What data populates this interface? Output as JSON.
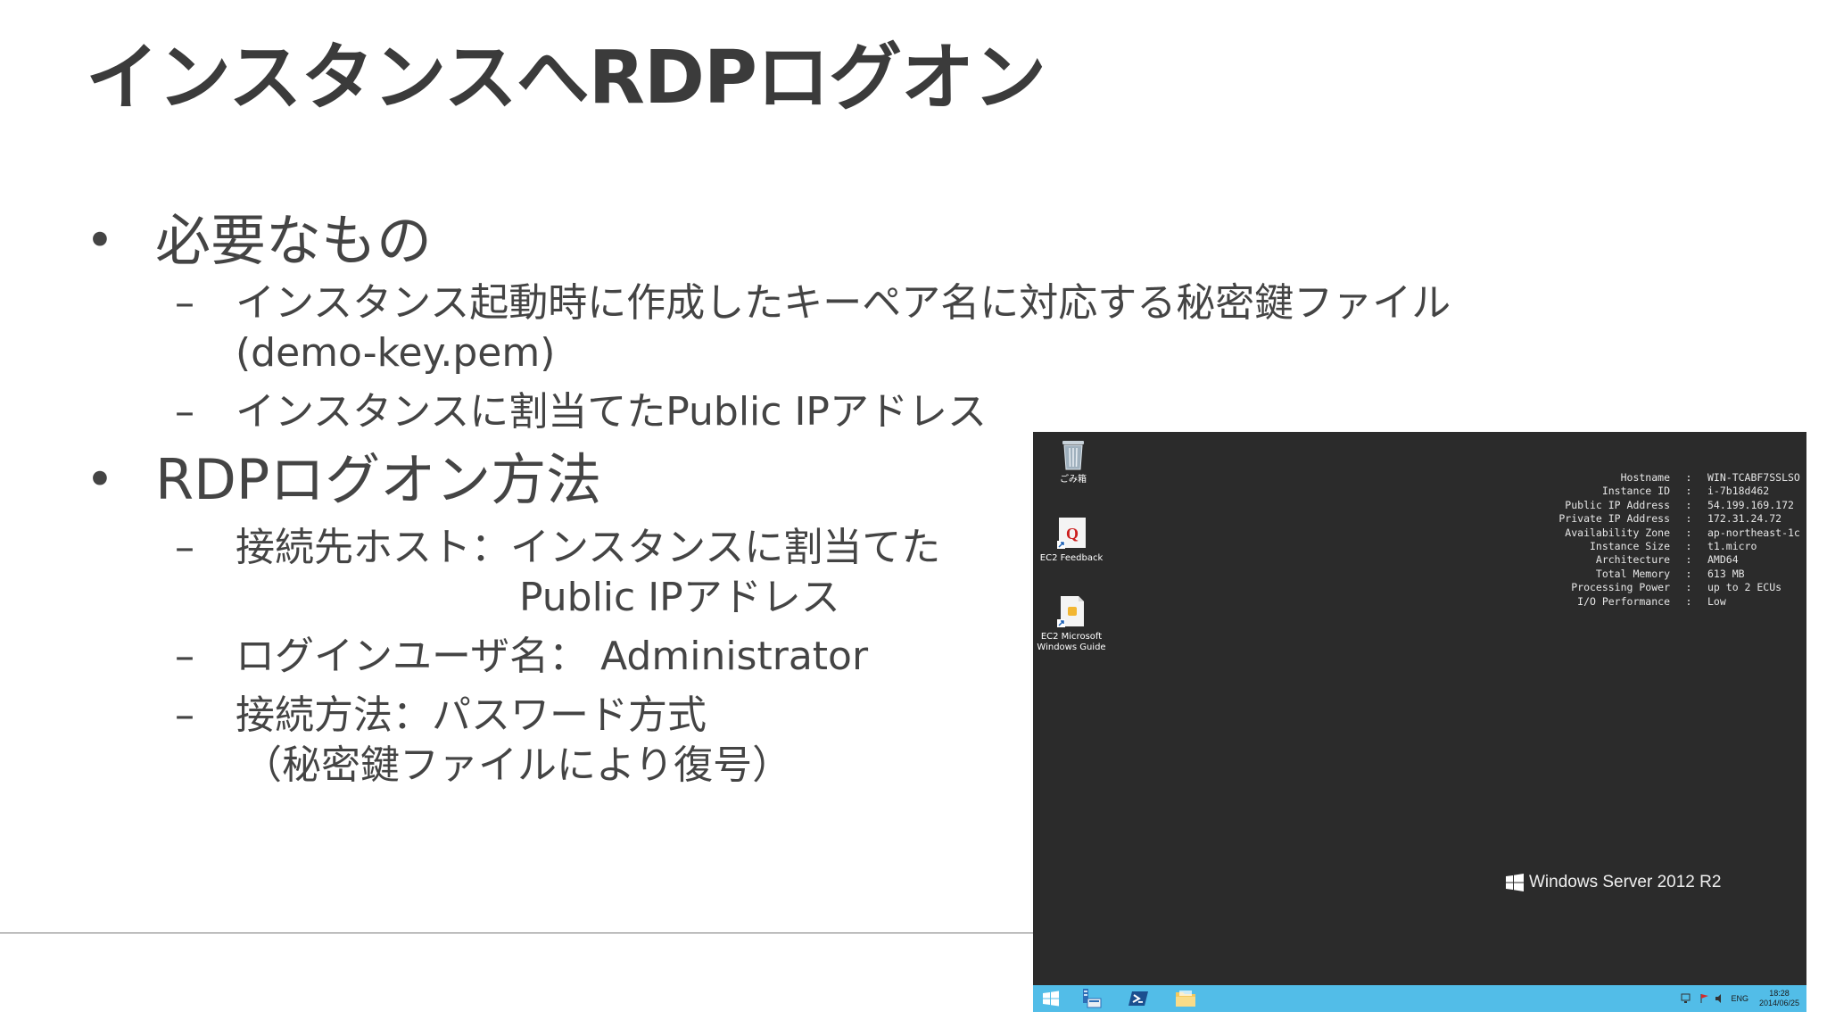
{
  "slide": {
    "title": "インスタンスへRDPログオン",
    "bullets": [
      {
        "label": "必要なもの",
        "items": [
          {
            "lines": [
              "インスタンス起動時に作成したキーペア名に対応する秘密鍵ファイル",
              "(demo-key.pem)"
            ]
          },
          {
            "lines": [
              "インスタンスに割当てたPublic IPアドレス"
            ]
          }
        ]
      },
      {
        "label": "RDPログオン方法",
        "items": [
          {
            "lines": [
              "接続先ホスト：インスタンスに割当てた",
              "Public IPアドレス"
            ]
          },
          {
            "lines": [
              "ログインユーザ名： Administrator"
            ]
          },
          {
            "lines": [
              "接続方法：パスワード方式",
              "（秘密鍵ファイルにより復号）"
            ]
          }
        ]
      }
    ],
    "bullet_glyph": "•",
    "dash_glyph": "–"
  },
  "rdp": {
    "desktop_icons": [
      {
        "label": "ごみ箱",
        "icon": "recycle-bin-icon"
      },
      {
        "label": "EC2 Feedback",
        "icon": "ec2-feedback-icon"
      },
      {
        "label": "EC2 Microsoft Windows Guide",
        "icon": "ec2-guide-icon"
      }
    ],
    "info": [
      {
        "key": "Hostname",
        "value": "WIN-TCABF7SSLSO"
      },
      {
        "key": "Instance ID",
        "value": "i-7b18d462"
      },
      {
        "key": "Public IP Address",
        "value": "54.199.169.172"
      },
      {
        "key": "Private IP Address",
        "value": "172.31.24.72"
      },
      {
        "key": "Availability Zone",
        "value": "ap-northeast-1c"
      },
      {
        "key": "Instance Size",
        "value": "t1.micro"
      },
      {
        "key": "Architecture",
        "value": "AMD64"
      },
      {
        "key": "Total Memory",
        "value": "613 MB"
      },
      {
        "key": "Processing Power",
        "value": "up to 2 ECUs"
      },
      {
        "key": "I/O Performance",
        "value": "Low"
      }
    ],
    "separator": ":",
    "branding": "Windows Server 2012 R2",
    "taskbar": {
      "buttons": [
        "start-icon",
        "server-manager-icon",
        "powershell-icon",
        "file-explorer-icon"
      ],
      "lang": "ENG",
      "time": "18:28",
      "date": "2014/06/25"
    },
    "colors": {
      "desktop": "#2b2b2b",
      "taskbar": "#52bde8"
    }
  }
}
